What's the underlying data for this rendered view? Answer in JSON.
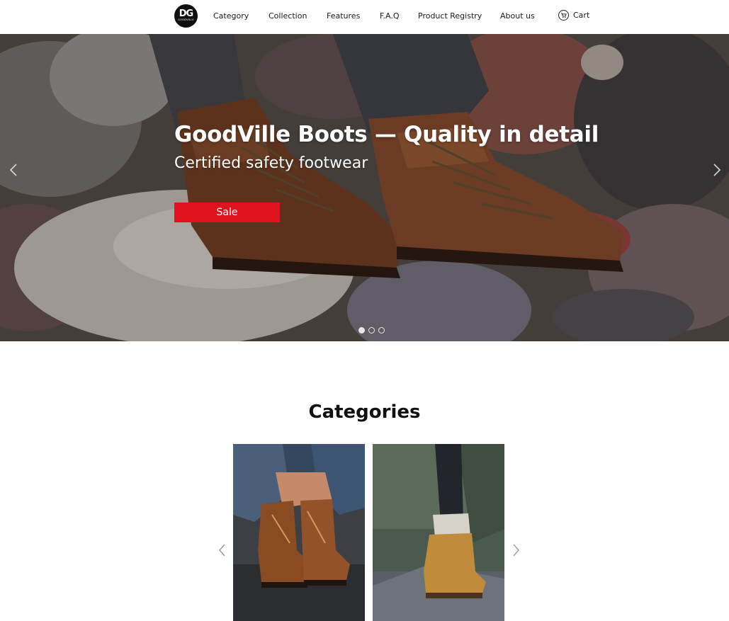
{
  "header": {
    "logo_mark": "DG",
    "logo_word": "GOODVILLE",
    "nav": [
      "Category",
      "Collection",
      "Features",
      "F.A.Q",
      "Product Registry",
      "About us"
    ],
    "cart_label": "Cart",
    "cart_icon": "cart-icon"
  },
  "hero": {
    "title": "GoodVille Boots — Quality in detail",
    "subtitle": "Certified safety footwear",
    "cta_label": "Sale",
    "prev_icon": "chevron-left-icon",
    "next_icon": "chevron-right-icon",
    "slides_total": 3,
    "active_slide": 1
  },
  "categories": {
    "title": "Categories",
    "prev_icon": "chevron-left-icon",
    "next_icon": "chevron-right-icon"
  },
  "colors": {
    "accent": "#e0121e",
    "text": "#111111",
    "background": "#ffffff"
  }
}
